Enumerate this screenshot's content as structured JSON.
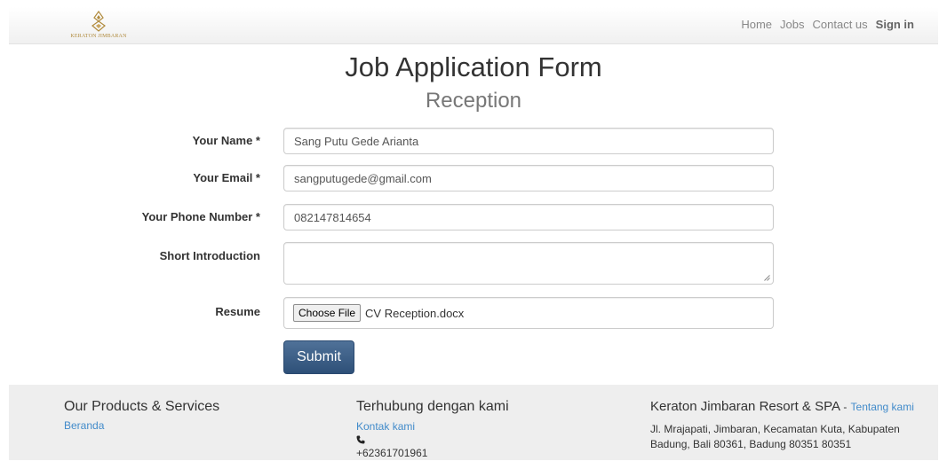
{
  "brand": {
    "name": "KERATON JIMBARAN"
  },
  "nav": {
    "home": "Home",
    "jobs": "Jobs",
    "contact": "Contact us",
    "signin": "Sign in"
  },
  "page": {
    "title": "Job Application Form",
    "subtitle": "Reception"
  },
  "form": {
    "name_label": "Your Name *",
    "name_value": "Sang Putu Gede Arianta",
    "email_label": "Your Email *",
    "email_value": "sangputugede@gmail.com",
    "phone_label": "Your Phone Number *",
    "phone_value": "082147814654",
    "intro_label": "Short Introduction",
    "intro_value": "",
    "resume_label": "Resume",
    "file_button": "Choose File",
    "file_name": "CV Reception.docx",
    "submit": "Submit"
  },
  "footer": {
    "col1": {
      "heading": "Our Products & Services",
      "link": "Beranda"
    },
    "col2": {
      "heading": "Terhubung dengan kami",
      "link": "Kontak kami",
      "icon": "phone-icon",
      "phone": "+62361701961"
    },
    "col3": {
      "heading": "Keraton Jimbaran Resort & SPA",
      "separator": "-",
      "link": "Tentang kami",
      "address_line1": "Jl. Mrajapati, Jimbaran, Kecamatan Kuta, Kabupaten",
      "address_line2": "Badung, Bali 80361, Badung 80351 80351"
    }
  },
  "colors": {
    "accent": "#3d5f87",
    "link": "#428bca",
    "footer_bg": "#eeeeee",
    "brand_gold": "#b08a3c"
  }
}
